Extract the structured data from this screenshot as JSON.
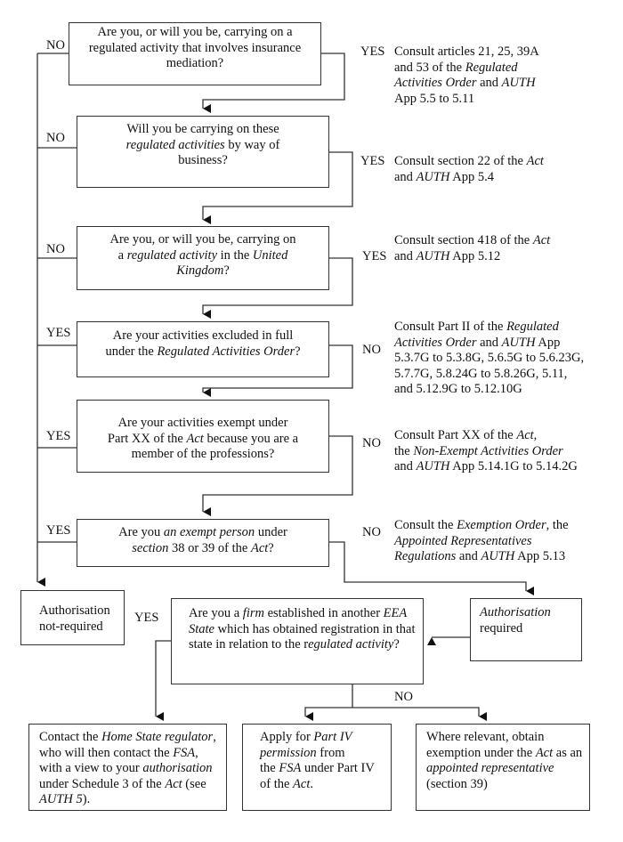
{
  "diagram": {
    "type": "flowchart",
    "questions": [
      {
        "id": "q1",
        "segments": [
          {
            "t": "Are you, or will you be, carrying on a"
          },
          {
            "br": true
          },
          {
            "t": "regulated activity that involves insurance"
          },
          {
            "br": true
          },
          {
            "t": "mediation?"
          }
        ],
        "no_label": "NO",
        "yes_label": "YES",
        "note": [
          {
            "t": "Consult articles 21, 25, 39A"
          },
          {
            "br": true
          },
          {
            "t": "and 53 of the "
          },
          {
            "t": "Regulated",
            "i": true
          },
          {
            "br": true
          },
          {
            "t": "Activities Order",
            "i": true
          },
          {
            "t": " and "
          },
          {
            "t": "AUTH",
            "i": true
          },
          {
            "br": true
          },
          {
            "t": "App 5.5 to 5.11"
          }
        ]
      },
      {
        "id": "q2",
        "segments": [
          {
            "t": "Will you be carrying on these"
          },
          {
            "br": true
          },
          {
            "t": "regulated activities",
            "i": true
          },
          {
            "t": " by way of"
          },
          {
            "br": true
          },
          {
            "t": "business?"
          }
        ],
        "no_label": "NO",
        "yes_label": "YES",
        "note": [
          {
            "t": "Consult section 22 of the "
          },
          {
            "t": "Act",
            "i": true
          },
          {
            "br": true
          },
          {
            "t": "and "
          },
          {
            "t": "AUTH",
            "i": true
          },
          {
            "t": " App 5.4"
          }
        ]
      },
      {
        "id": "q3",
        "segments": [
          {
            "t": "Are you, or will you be, carrying on"
          },
          {
            "br": true
          },
          {
            "t": "a "
          },
          {
            "t": "regulated activity",
            "i": true
          },
          {
            "t": " in the "
          },
          {
            "t": "United",
            "i": true
          },
          {
            "br": true
          },
          {
            "t": "Kingdom",
            "i": true
          },
          {
            "t": "?"
          }
        ],
        "no_label": "NO",
        "yes_label": "YES",
        "note": [
          {
            "t": "Consult section 418 of the "
          },
          {
            "t": "Act",
            "i": true
          },
          {
            "br": true
          },
          {
            "t": "and "
          },
          {
            "t": "AUTH",
            "i": true
          },
          {
            "t": " App 5.12"
          }
        ]
      },
      {
        "id": "q4",
        "segments": [
          {
            "t": "Are your activities excluded in full"
          },
          {
            "br": true
          },
          {
            "t": "under the "
          },
          {
            "t": "Regulated Activities Order",
            "i": true
          },
          {
            "t": "?"
          }
        ],
        "yes_label": "YES",
        "no_label": "NO",
        "note": [
          {
            "t": "Consult Part II of the "
          },
          {
            "t": "Regulated",
            "i": true
          },
          {
            "br": true
          },
          {
            "t": "Activities Order",
            "i": true
          },
          {
            "t": " and "
          },
          {
            "t": "AUTH",
            "i": true
          },
          {
            "t": " App"
          },
          {
            "br": true
          },
          {
            "t": "5.3.7G to 5.3.8G, 5.6.5G to 5.6.23G,"
          },
          {
            "br": true
          },
          {
            "t": "5.7.7G, 5.8.24G to 5.8.26G, 5.11,"
          },
          {
            "br": true
          },
          {
            "t": "and 5.12.9G to 5.12.10G"
          }
        ]
      },
      {
        "id": "q5",
        "segments": [
          {
            "t": "Are your activities exempt under"
          },
          {
            "br": true
          },
          {
            "t": "Part XX of the "
          },
          {
            "t": "Act",
            "i": true
          },
          {
            "t": " because you are a"
          },
          {
            "br": true
          },
          {
            "t": "member of the professions?"
          }
        ],
        "yes_label": "YES",
        "no_label": "NO",
        "note": [
          {
            "t": "Consult Part XX of the "
          },
          {
            "t": "Act",
            "i": true
          },
          {
            "t": ","
          },
          {
            "br": true
          },
          {
            "t": "the "
          },
          {
            "t": "Non-Exempt Activities Order",
            "i": true
          },
          {
            "br": true
          },
          {
            "t": "and "
          },
          {
            "t": "AUTH",
            "i": true
          },
          {
            "t": " App 5.14.1G to 5.14.2G"
          }
        ]
      },
      {
        "id": "q6",
        "segments": [
          {
            "t": "Are you "
          },
          {
            "t": "an exempt person",
            "i": true
          },
          {
            "t": " under"
          },
          {
            "br": true
          },
          {
            "t": "section",
            "i": true
          },
          {
            "t": " 38 or 39 of the "
          },
          {
            "t": "Act",
            "i": true
          },
          {
            "t": "?"
          }
        ],
        "yes_label": "YES",
        "no_label": "NO",
        "note": [
          {
            "t": "Consult the "
          },
          {
            "t": "Exemption Order",
            "i": true
          },
          {
            "t": ", the"
          },
          {
            "br": true
          },
          {
            "t": "Appointed Representatives",
            "i": true
          },
          {
            "br": true
          },
          {
            "t": "Regulations",
            "i": true
          },
          {
            "t": " and "
          },
          {
            "t": "AUTH",
            "i": true
          },
          {
            "t": " App 5.13"
          }
        ]
      }
    ],
    "auth_not_required": [
      {
        "t": "Authorisation"
      },
      {
        "br": true
      },
      {
        "t": "not-required"
      }
    ],
    "auth_required": [
      {
        "t": "Authorisation",
        "i": true
      },
      {
        "br": true
      },
      {
        "t": "required"
      }
    ],
    "eea_question": {
      "segments": [
        {
          "t": "Are you a "
        },
        {
          "t": "firm",
          "i": true
        },
        {
          "t": " established in another "
        },
        {
          "t": "EEA",
          "i": true
        },
        {
          "br": true
        },
        {
          "t": "State",
          "i": true
        },
        {
          "t": " which has obtained registration in that"
        },
        {
          "br": true
        },
        {
          "t": "state in relation to the r"
        },
        {
          "t": "egulated activity",
          "i": true
        },
        {
          "t": "?"
        }
      ],
      "yes_label": "YES",
      "no_label": "NO"
    },
    "outcomes": [
      {
        "id": "home-state",
        "segments": [
          {
            "t": "Contact the "
          },
          {
            "t": "Home State regulator",
            "i": true
          },
          {
            "t": ","
          },
          {
            "br": true
          },
          {
            "t": "who will then contact the "
          },
          {
            "t": "FSA",
            "i": true
          },
          {
            "t": ","
          },
          {
            "br": true
          },
          {
            "t": "with a view to your "
          },
          {
            "t": "authorisation",
            "i": true
          },
          {
            "br": true
          },
          {
            "t": "under Schedule 3 of the "
          },
          {
            "t": "Act",
            "i": true
          },
          {
            "t": " (see"
          },
          {
            "br": true
          },
          {
            "t": "AUTH 5",
            "i": true
          },
          {
            "t": ")."
          }
        ]
      },
      {
        "id": "part-iv",
        "segments": [
          {
            "t": "Apply for "
          },
          {
            "t": "Part IV",
            "i": true
          },
          {
            "br": true
          },
          {
            "t": "permission",
            "i": true
          },
          {
            "t": " from"
          },
          {
            "br": true
          },
          {
            "t": "the "
          },
          {
            "t": "FSA",
            "i": true
          },
          {
            "t": " under Part IV"
          },
          {
            "br": true
          },
          {
            "t": "of the "
          },
          {
            "t": "Act",
            "i": true
          },
          {
            "t": "."
          }
        ]
      },
      {
        "id": "appointed-rep",
        "segments": [
          {
            "t": "Where relevant, obtain"
          },
          {
            "br": true
          },
          {
            "t": "exemption under the "
          },
          {
            "t": "Act",
            "i": true
          },
          {
            "t": " as an"
          },
          {
            "br": true
          },
          {
            "t": "appointed representative",
            "i": true
          },
          {
            "br": true
          },
          {
            "t": "(section 39)"
          }
        ]
      }
    ]
  }
}
